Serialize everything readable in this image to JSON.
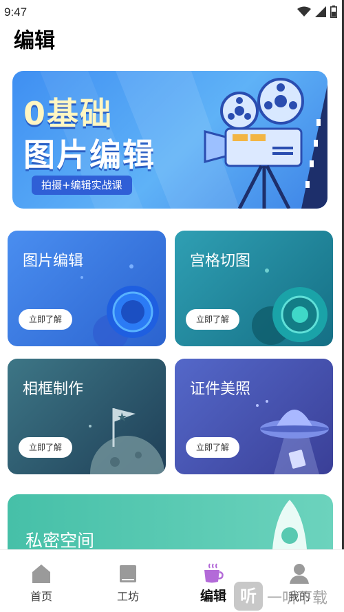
{
  "status": {
    "time": "9:47"
  },
  "page": {
    "title": "编辑"
  },
  "banner": {
    "title_line1": "0基础",
    "title_line2": "图片编辑",
    "tag": "拍摄+编辑实战课"
  },
  "cards": [
    {
      "title": "图片编辑",
      "button": "立即了解"
    },
    {
      "title": "宫格切图",
      "button": "立即了解"
    },
    {
      "title": "相框制作",
      "button": "立即了解"
    },
    {
      "title": "证件美照",
      "button": "立即了解"
    }
  ],
  "private_space": {
    "title": "私密空间"
  },
  "tabs": [
    {
      "label": "首页",
      "icon": "home-icon"
    },
    {
      "label": "工坊",
      "icon": "book-icon"
    },
    {
      "label": "编辑",
      "icon": "coffee-cup-icon",
      "active": true
    },
    {
      "label": "我的",
      "icon": "user-icon"
    }
  ],
  "watermark": {
    "logo": "听",
    "text": "一听下载"
  },
  "colors": {
    "active_tab": "#b36ad8",
    "inactive_tab": "#9a9a9a"
  }
}
